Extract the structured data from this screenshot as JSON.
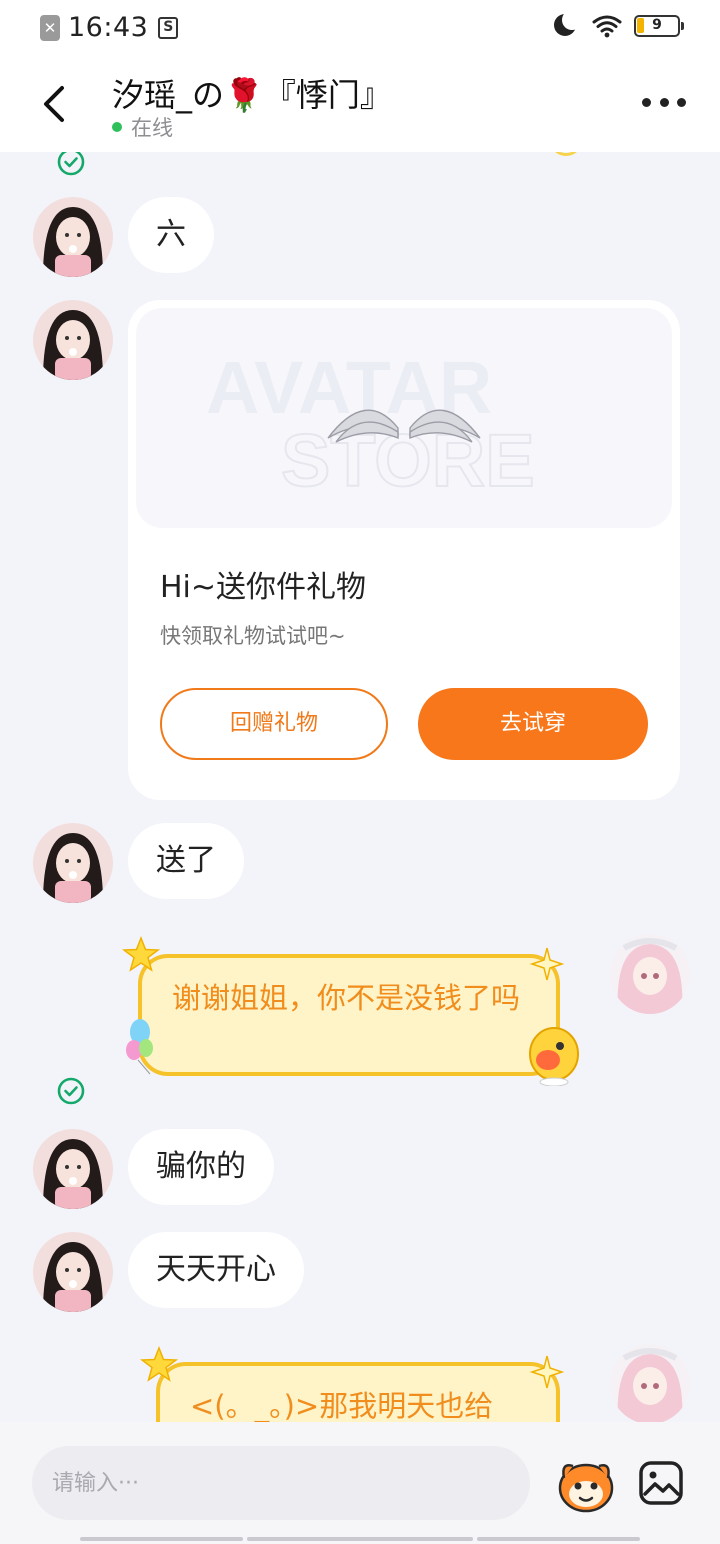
{
  "status_bar": {
    "time": "16:43",
    "battery": "9"
  },
  "header": {
    "title": "汐瑶_の🌹『悸门』",
    "status": "在线"
  },
  "messages": {
    "m1": "六",
    "m3": "送了",
    "m4": "谢谢姐姐，你不是没钱了吗",
    "m5": "骗你的",
    "m6": "天天开心",
    "m7": "<(。_。)>那我明天也给"
  },
  "gift_card": {
    "banner_text_1": "AVATAR",
    "banner_text_2": "STORE",
    "title": "Hi~送你件礼物",
    "subtitle": "快领取礼物试试吧~",
    "return_gift_label": "回赠礼物",
    "try_on_label": "去试穿"
  },
  "input": {
    "placeholder": "请输入···"
  },
  "colors": {
    "accent": "#f7771a",
    "online": "#2ec05a",
    "bubble_gold": "#f6c22a",
    "read_check": "#14a86a"
  }
}
